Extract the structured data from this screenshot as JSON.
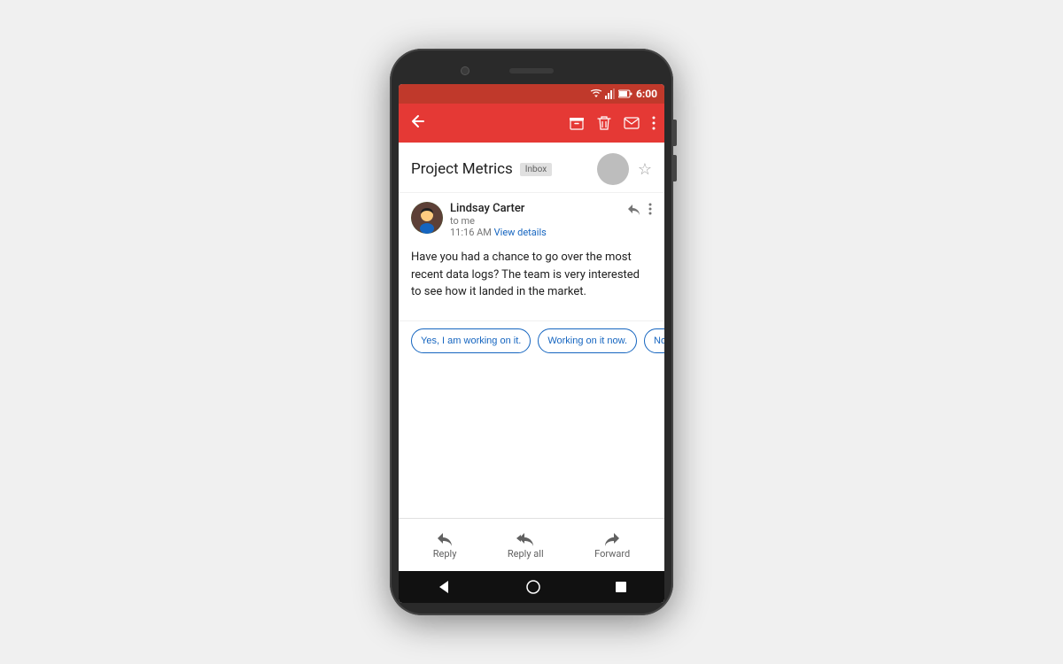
{
  "status_bar": {
    "time": "6:00"
  },
  "toolbar": {
    "back_label": "←",
    "actions": [
      "archive",
      "delete",
      "mail",
      "more"
    ]
  },
  "email": {
    "subject": "Project Metrics",
    "badge": "Inbox",
    "sender": {
      "name": "Lindsay Carter",
      "to": "to me",
      "time": "11:16 AM",
      "view_details": "View details"
    },
    "body": "Have you had a chance to go over the most recent data logs? The team is very interested to see how it landed in the market."
  },
  "smart_replies": [
    "Yes, I am working on it.",
    "Working on it now.",
    "No, I have not."
  ],
  "bottom_actions": [
    {
      "id": "reply",
      "label": "Reply"
    },
    {
      "id": "reply-all",
      "label": "Reply all"
    },
    {
      "id": "forward",
      "label": "Forward"
    }
  ],
  "nav_bar": {
    "back": "◀",
    "home": "○",
    "recent": "▪"
  }
}
